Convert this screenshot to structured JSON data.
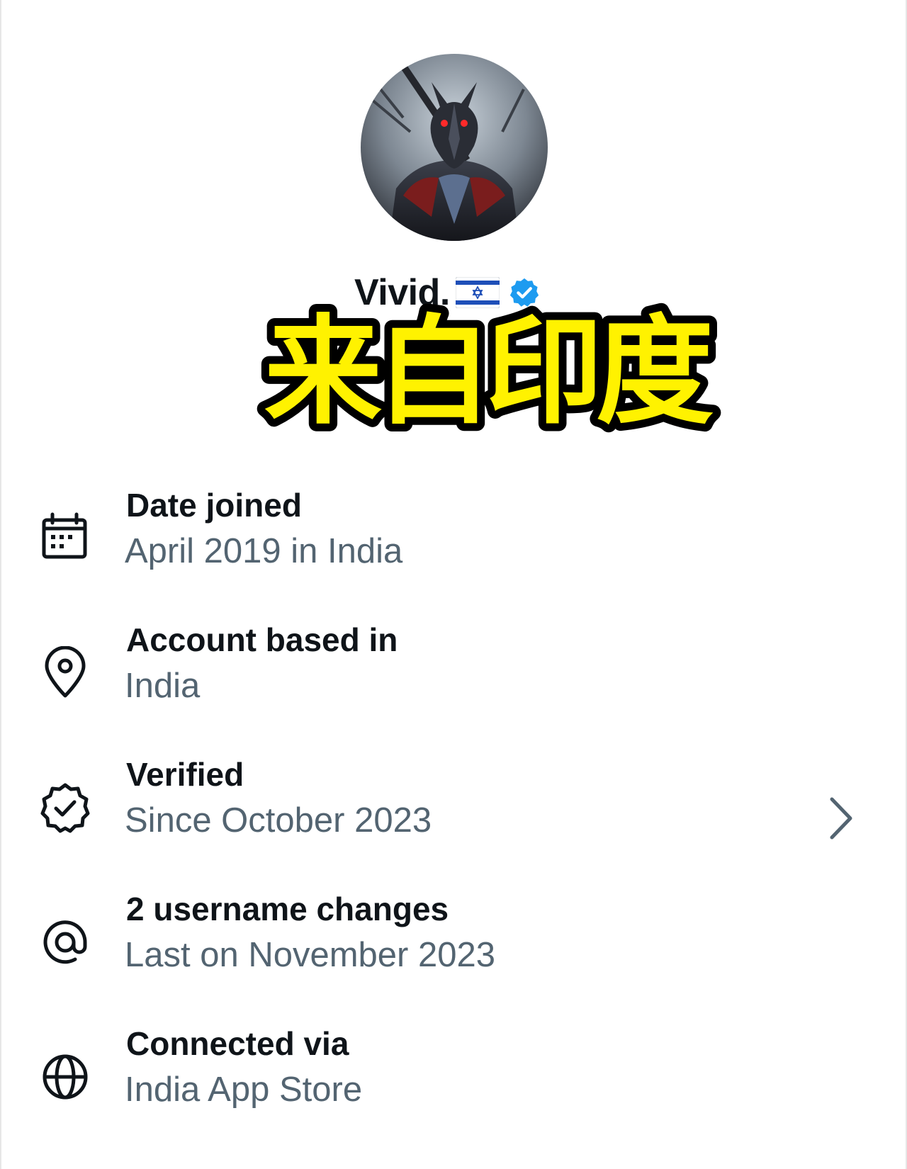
{
  "profile": {
    "display_name": "Vivid.",
    "flag_icon": "israel-flag-icon",
    "verified_icon": "verified-badge-icon",
    "handle": "@"
  },
  "overlay": {
    "caption": "来自印度",
    "fill_color": "#fff200",
    "stroke_color": "#000000"
  },
  "info": {
    "date_joined": {
      "icon": "calendar-icon",
      "title": "Date joined",
      "subtitle": "April 2019 in India"
    },
    "account_based": {
      "icon": "location-pin-icon",
      "title": "Account based in",
      "subtitle": "India"
    },
    "verified": {
      "icon": "verified-check-icon",
      "title": "Verified",
      "subtitle": "Since October 2023",
      "action_icon": "chevron-right-icon"
    },
    "username_changes": {
      "icon": "at-sign-icon",
      "title": "2 username changes",
      "subtitle": "Last on November 2023"
    },
    "connected_via": {
      "icon": "globe-icon",
      "title": "Connected via",
      "subtitle": "India App Store"
    }
  },
  "colors": {
    "primary_text": "#0f1419",
    "secondary_text": "#536471",
    "verified_blue": "#1d9bf0"
  }
}
